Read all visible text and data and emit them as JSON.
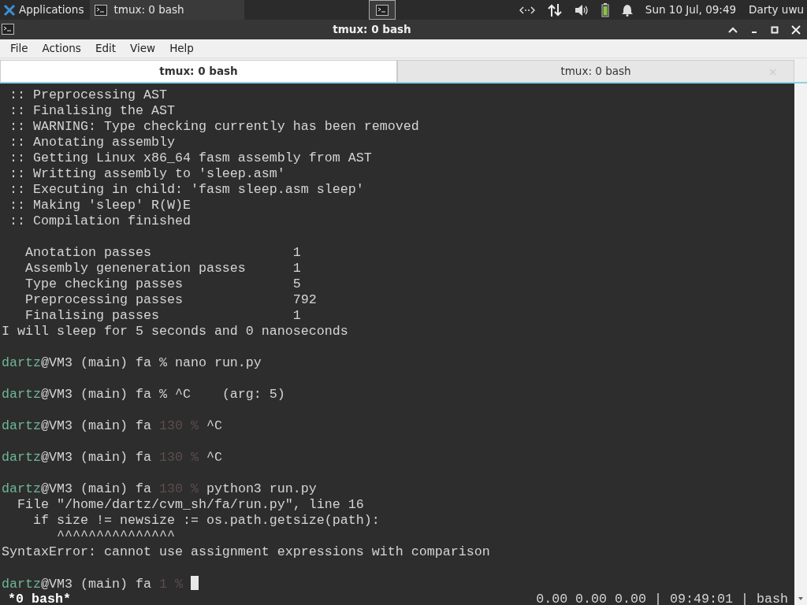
{
  "panel": {
    "menu_label": "Applications",
    "task": {
      "label": "tmux: 0 bash",
      "selected": false
    },
    "clock": "Sun 10 Jul, 09:49",
    "user": "Darty uwu"
  },
  "window": {
    "title": "tmux: 0 bash"
  },
  "menu": [
    "File",
    "Actions",
    "Edit",
    "View",
    "Help"
  ],
  "tabs": [
    {
      "label": "tmux: 0 bash",
      "selected": true
    },
    {
      "label": "tmux: 0 bash",
      "selected": false
    }
  ],
  "terminal": {
    "lines": [
      {
        "kind": "text",
        "segments": [
          {
            "kind": "plain",
            "text": " :: Preprocessing AST"
          }
        ]
      },
      {
        "kind": "text",
        "segments": [
          {
            "kind": "plain",
            "text": " :: Finalising the AST"
          }
        ]
      },
      {
        "kind": "text",
        "segments": [
          {
            "kind": "plain",
            "text": " :: WARNING: Type checking currently has been removed"
          }
        ]
      },
      {
        "kind": "text",
        "segments": [
          {
            "kind": "plain",
            "text": " :: Anotating assembly"
          }
        ]
      },
      {
        "kind": "text",
        "segments": [
          {
            "kind": "plain",
            "text": " :: Getting Linux x86_64 fasm assembly from AST"
          }
        ]
      },
      {
        "kind": "text",
        "segments": [
          {
            "kind": "plain",
            "text": " :: Writting assembly to 'sleep.asm'"
          }
        ]
      },
      {
        "kind": "text",
        "segments": [
          {
            "kind": "plain",
            "text": " :: Executing in child: 'fasm sleep.asm sleep'"
          }
        ]
      },
      {
        "kind": "text",
        "segments": [
          {
            "kind": "plain",
            "text": " :: Making 'sleep' R(W)E"
          }
        ]
      },
      {
        "kind": "text",
        "segments": [
          {
            "kind": "plain",
            "text": " :: Compilation finished"
          }
        ]
      },
      {
        "kind": "blank"
      },
      {
        "kind": "text",
        "segments": [
          {
            "kind": "plain",
            "text": "   Anotation passes                  1"
          }
        ]
      },
      {
        "kind": "text",
        "segments": [
          {
            "kind": "plain",
            "text": "   Assembly geneneration passes      1"
          }
        ]
      },
      {
        "kind": "text",
        "segments": [
          {
            "kind": "plain",
            "text": "   Type checking passes              5"
          }
        ]
      },
      {
        "kind": "text",
        "segments": [
          {
            "kind": "plain",
            "text": "   Preprocessing passes              792"
          }
        ]
      },
      {
        "kind": "text",
        "segments": [
          {
            "kind": "plain",
            "text": "   Finalising passes                 1"
          }
        ]
      },
      {
        "kind": "text",
        "segments": [
          {
            "kind": "plain",
            "text": "I will sleep for 5 seconds and 0 nanoseconds"
          }
        ]
      },
      {
        "kind": "blank"
      },
      {
        "kind": "prompt",
        "segments": [
          {
            "kind": "user",
            "text": "dartz"
          },
          {
            "kind": "plain",
            "text": "@VM3 (main) fa % nano run.py"
          }
        ]
      },
      {
        "kind": "blank"
      },
      {
        "kind": "prompt",
        "segments": [
          {
            "kind": "user",
            "text": "dartz"
          },
          {
            "kind": "plain",
            "text": "@VM3 (main) fa % ^C    (arg: 5)"
          }
        ]
      },
      {
        "kind": "blank"
      },
      {
        "kind": "prompt",
        "segments": [
          {
            "kind": "user",
            "text": "dartz"
          },
          {
            "kind": "plain",
            "text": "@VM3 (main) fa "
          },
          {
            "kind": "dim",
            "text": "130 %"
          },
          {
            "kind": "plain",
            "text": " ^C"
          }
        ]
      },
      {
        "kind": "blank"
      },
      {
        "kind": "prompt",
        "segments": [
          {
            "kind": "user",
            "text": "dartz"
          },
          {
            "kind": "plain",
            "text": "@VM3 (main) fa "
          },
          {
            "kind": "dim",
            "text": "130 %"
          },
          {
            "kind": "plain",
            "text": " ^C"
          }
        ]
      },
      {
        "kind": "blank"
      },
      {
        "kind": "prompt",
        "segments": [
          {
            "kind": "user",
            "text": "dartz"
          },
          {
            "kind": "plain",
            "text": "@VM3 (main) fa "
          },
          {
            "kind": "dim",
            "text": "130 %"
          },
          {
            "kind": "plain",
            "text": " python3 run.py"
          }
        ]
      },
      {
        "kind": "text",
        "segments": [
          {
            "kind": "plain",
            "text": "  File \"/home/dartz/cvm_sh/fa/run.py\", line 16"
          }
        ]
      },
      {
        "kind": "text",
        "segments": [
          {
            "kind": "plain",
            "text": "    if size != newsize := os.path.getsize(path):"
          }
        ]
      },
      {
        "kind": "text",
        "segments": [
          {
            "kind": "plain",
            "text": "       ^^^^^^^^^^^^^^^"
          }
        ]
      },
      {
        "kind": "text",
        "segments": [
          {
            "kind": "plain",
            "text": "SyntaxError: cannot use assignment expressions with comparison"
          }
        ]
      },
      {
        "kind": "blank"
      },
      {
        "kind": "prompt",
        "segments": [
          {
            "kind": "user",
            "text": "dartz"
          },
          {
            "kind": "plain",
            "text": "@VM3 (main) fa "
          },
          {
            "kind": "dim",
            "text": "1 %"
          },
          {
            "kind": "cursor"
          }
        ]
      }
    ],
    "status_left": "*0 bash*",
    "status_right": "0.00 0.00 0.00 | 09:49:01 | bash"
  }
}
